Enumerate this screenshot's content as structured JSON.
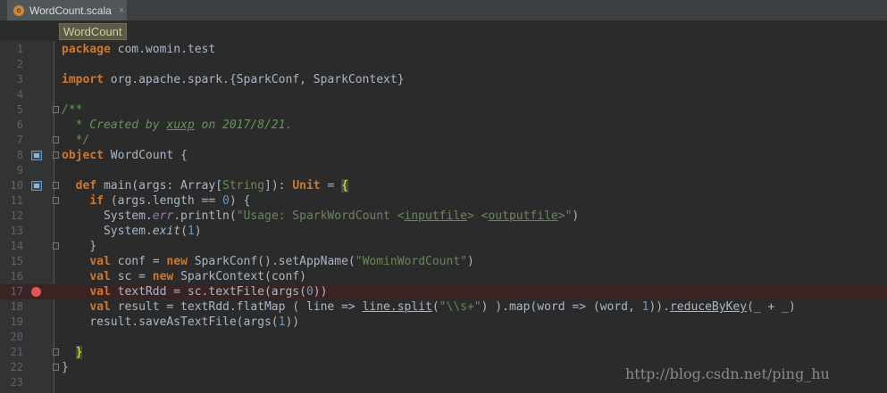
{
  "tab": {
    "file_name": "WordCount.scala",
    "close": "×",
    "icon_letter": "o"
  },
  "breadcrumb": {
    "label": "WordCount"
  },
  "editor": {
    "lines": [
      {
        "n": "1",
        "html": "<span class=\"kw\">package</span> com.womin.test"
      },
      {
        "n": "2",
        "html": ""
      },
      {
        "n": "3",
        "html": "<span class=\"kw\">import</span> org.apache.spark.{SparkConf, SparkContext}"
      },
      {
        "n": "4",
        "html": ""
      },
      {
        "n": "5",
        "html": "<span class=\"doc\">/**</span>"
      },
      {
        "n": "6",
        "html": "<span class=\"doc\">  * Created by <span class=\"under\">xuxp</span> on 2017/8/21.</span>"
      },
      {
        "n": "7",
        "html": "<span class=\"doc\">  */</span>"
      },
      {
        "n": "8",
        "html": "<span class=\"kw\">object</span> WordCount {"
      },
      {
        "n": "9",
        "html": ""
      },
      {
        "n": "10",
        "html": "  <span class=\"kw\">def</span> main(args: Array[<span class=\"type\">String</span>]): <span class=\"kw\">Unit</span> = <span class=\"hl\">{</span>"
      },
      {
        "n": "11",
        "html": "    <span class=\"kw\">if</span> (args.length == <span class=\"num\">0</span>) {"
      },
      {
        "n": "12",
        "html": "      System.<span style=\"color:#9876aa;font-style:italic\">err</span>.println(<span class=\"str\">\"Usage: SparkWordCount &lt;<span class=\"under\">inputfile</span>&gt; &lt;<span class=\"under\">outputfile</span>&gt;\"</span>)"
      },
      {
        "n": "13",
        "html": "      System.<span style=\"font-style:italic\">exit</span>(<span class=\"num\">1</span>)"
      },
      {
        "n": "14",
        "html": "    }"
      },
      {
        "n": "15",
        "html": "    <span class=\"kw\">val</span> conf = <span class=\"kw\">new</span> SparkConf().setAppName(<span class=\"str\">\"WominWordCount\"</span>)"
      },
      {
        "n": "16",
        "html": "    <span class=\"kw\">val</span> sc = <span class=\"kw\">new</span> SparkContext(conf)"
      },
      {
        "n": "17",
        "html": "    <span class=\"kw\">val</span> textRdd = sc.textFile(args(<span class=\"num\">0</span>))"
      },
      {
        "n": "18",
        "html": "    <span class=\"kw\">val</span> result = textRdd.flatMap ( line =&gt; <span class=\"under\">line.split</span>(<span class=\"str\">\"\\\\s+\"</span>) ).map(word =&gt; (word, <span class=\"num\">1</span>)).<span class=\"under\">reduceByKey</span>(_ + _)"
      },
      {
        "n": "19",
        "html": "    result.saveAsTextFile(args(<span class=\"num\">1</span>))"
      },
      {
        "n": "20",
        "html": ""
      },
      {
        "n": "21",
        "html": "  <span class=\"hl\">}</span>"
      },
      {
        "n": "22",
        "html": "}"
      },
      {
        "n": "23",
        "html": ""
      }
    ],
    "markers": {
      "override": [
        "8",
        "10"
      ],
      "breakpoint": [
        "17"
      ],
      "fold": [
        "5",
        "7",
        "8",
        "10",
        "11",
        "14",
        "21",
        "22"
      ]
    }
  },
  "watermark": "http://blog.csdn.net/ping_hu",
  "colors": {
    "keyword": "#cc7832",
    "string": "#6a8759",
    "number": "#6897bb",
    "doc": "#629755",
    "breakpoint": "#e05555"
  }
}
